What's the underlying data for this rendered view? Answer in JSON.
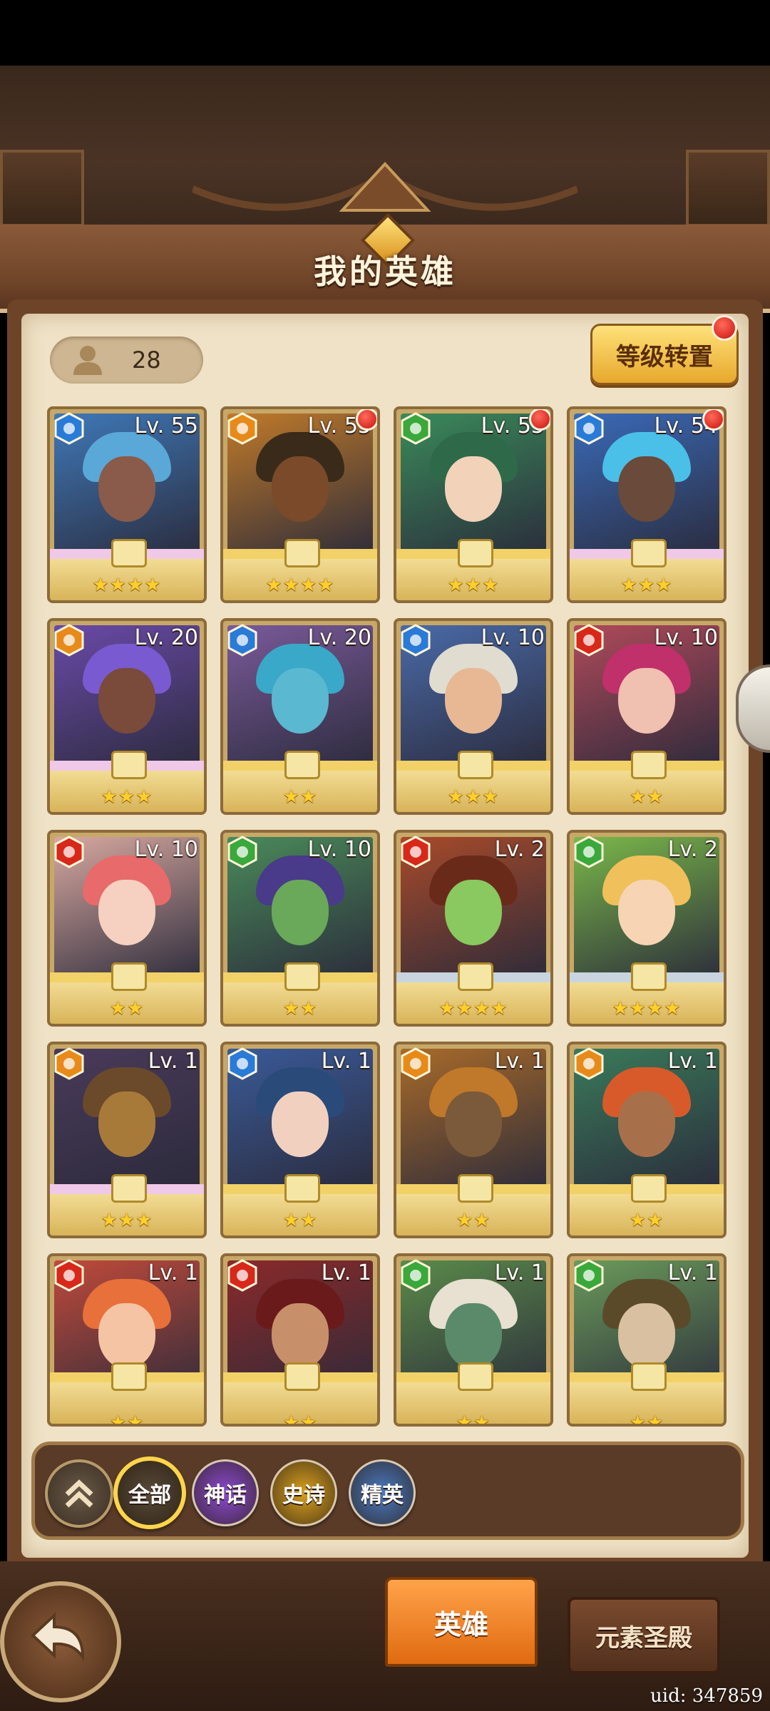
{
  "title": "我的英雄",
  "hero_count": "28",
  "level_transfer_label": "等级转置",
  "heroes": [
    {
      "level": "Lv. 55",
      "element": "water",
      "stars": "★★★★",
      "rarity": "mythic",
      "portrait": "#3f78b8",
      "hair": "#5aa8d8",
      "face": "#8a5a4a",
      "dot": false
    },
    {
      "level": "Lv. 55",
      "element": "fire",
      "stars": "★★★★",
      "rarity": "epic",
      "portrait": "#c07a2a",
      "hair": "#3a2a1a",
      "face": "#7a4a2a",
      "dot": true
    },
    {
      "level": "Lv. 55",
      "element": "wind",
      "stars": "★★★",
      "rarity": "epic",
      "portrait": "#3a8a5a",
      "hair": "#2e6a4a",
      "face": "#f2d2b8",
      "dot": true
    },
    {
      "level": "Lv. 54",
      "element": "water",
      "stars": "★★★",
      "rarity": "mythic",
      "portrait": "#3a6ab8",
      "hair": "#4ac0e8",
      "face": "#6a4a3a",
      "dot": true
    },
    {
      "level": "Lv. 20",
      "element": "fire",
      "stars": "★★★",
      "rarity": "mythic",
      "portrait": "#6a4aa8",
      "hair": "#7a5ad0",
      "face": "#7a4a3a",
      "dot": false
    },
    {
      "level": "Lv. 20",
      "element": "water",
      "stars": "★★",
      "rarity": "epic",
      "portrait": "#7a5a9a",
      "hair": "#3aa8c8",
      "face": "#5ab8d0",
      "dot": false
    },
    {
      "level": "Lv. 10",
      "element": "water",
      "stars": "★★★",
      "rarity": "epic",
      "portrait": "#4a6aa8",
      "hair": "#e0dcd0",
      "face": "#e8b894",
      "dot": false
    },
    {
      "level": "Lv. 10",
      "element": "red",
      "stars": "★★",
      "rarity": "epic",
      "portrait": "#b04a5a",
      "hair": "#c0306a",
      "face": "#f0c0b0",
      "dot": false
    },
    {
      "level": "Lv. 10",
      "element": "red",
      "stars": "★★",
      "rarity": "epic",
      "portrait": "#d8a8a0",
      "hair": "#e86a6a",
      "face": "#f6d0c0",
      "dot": false
    },
    {
      "level": "Lv. 10",
      "element": "wind",
      "stars": "★★",
      "rarity": "epic",
      "portrait": "#4a8a5a",
      "hair": "#4a3a8a",
      "face": "#6aa85a",
      "dot": false
    },
    {
      "level": "Lv. 2",
      "element": "red",
      "stars": "★★★★",
      "rarity": "legend",
      "portrait": "#a84a2a",
      "hair": "#6a2a1a",
      "face": "#8ac860",
      "dot": false
    },
    {
      "level": "Lv. 2",
      "element": "wind",
      "stars": "★★★★",
      "rarity": "legend",
      "portrait": "#7ab84a",
      "hair": "#f0c05a",
      "face": "#f6d4b4",
      "dot": false
    },
    {
      "level": "Lv. 1",
      "element": "fire",
      "stars": "★★★",
      "rarity": "mythic",
      "portrait": "#4a3a5a",
      "hair": "#6a4a2a",
      "face": "#a87a3a",
      "dot": false
    },
    {
      "level": "Lv. 1",
      "element": "water",
      "stars": "★★",
      "rarity": "epic",
      "portrait": "#3a5a98",
      "hair": "#2a4a7a",
      "face": "#f2d0c0",
      "dot": false
    },
    {
      "level": "Lv. 1",
      "element": "fire",
      "stars": "★★",
      "rarity": "epic",
      "portrait": "#a86a2a",
      "hair": "#c0782a",
      "face": "#7a5a3a",
      "dot": false
    },
    {
      "level": "Lv. 1",
      "element": "fire",
      "stars": "★★",
      "rarity": "epic",
      "portrait": "#3a7a5a",
      "hair": "#d85a2a",
      "face": "#a8704a",
      "dot": false
    },
    {
      "level": "Lv. 1",
      "element": "red",
      "stars": "★★",
      "rarity": "epic",
      "portrait": "#c04a3a",
      "hair": "#e8703a",
      "face": "#f4c4a4",
      "dot": false
    },
    {
      "level": "Lv. 1",
      "element": "red",
      "stars": "★★",
      "rarity": "epic",
      "portrait": "#8a2a2a",
      "hair": "#6a1a1a",
      "face": "#c8906a",
      "dot": false
    },
    {
      "level": "Lv. 1",
      "element": "wind",
      "stars": "★★",
      "rarity": "epic",
      "portrait": "#5a8a4a",
      "hair": "#e8e0d0",
      "face": "#5a8a6a",
      "dot": false
    },
    {
      "level": "Lv. 1",
      "element": "wind",
      "stars": "★★",
      "rarity": "epic",
      "portrait": "#6a9a5a",
      "hair": "#5a4a2a",
      "face": "#d8c0a0",
      "dot": false
    }
  ],
  "filters": [
    {
      "label": "全部",
      "color": "#3a2a1a",
      "active": true
    },
    {
      "label": "神话",
      "color": "#8a4ad0",
      "active": false
    },
    {
      "label": "史诗",
      "color": "#d8a020",
      "active": false
    },
    {
      "label": "精英",
      "color": "#4a78c0",
      "active": false
    }
  ],
  "tabs": {
    "heroes": "英雄",
    "temple": "元素圣殿"
  },
  "uid": "uid: 347859",
  "element_colors": {
    "water": "#2a7ad8",
    "fire": "#e88a1a",
    "wind": "#3aa83a",
    "red": "#d8281a"
  },
  "rarity_wing_colors": {
    "mythic": "#f0c8e8",
    "epic": "#f2d268",
    "legend": "#c8d4e0"
  }
}
